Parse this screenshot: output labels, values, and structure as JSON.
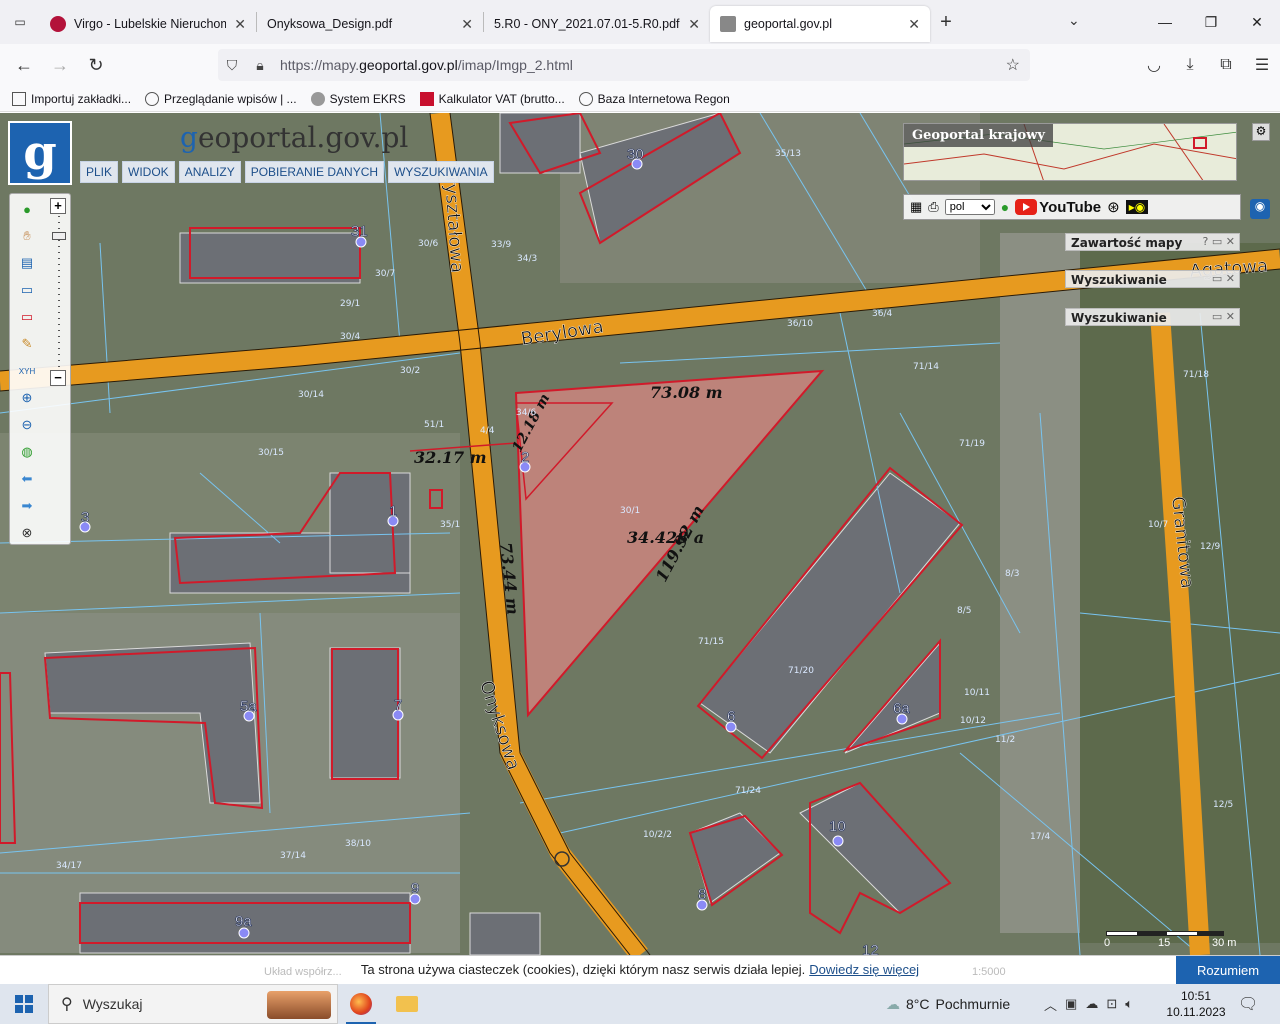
{
  "browser": {
    "tabs": [
      {
        "title": "Virgo - Lubelskie Nieruchomoś",
        "favicon_color": "#b3123a"
      },
      {
        "title": "Onyksowa_Design.pdf",
        "favicon_color": ""
      },
      {
        "title": "5.R0 - ONY_2021.07.01-5.R0.pdf",
        "favicon_color": ""
      },
      {
        "title": "geoportal.gov.pl",
        "favicon_color": "#777"
      }
    ],
    "active_tab": 3,
    "url_prefix": "https://mapy.",
    "url_domain": "geoportal.gov.pl",
    "url_suffix": "/imap/Imgp_2.html",
    "bookmarks": [
      "Importuj zakładki...",
      "Przeglądanie wpisów | ...",
      "System EKRS",
      "Kalkulator VAT (brutto...",
      "Baza Internetowa Regon"
    ]
  },
  "geoportal": {
    "logo_letter": "g",
    "logo_text_accent": "g",
    "logo_text_rest": "eoportal.gov.pl",
    "menu": [
      "PLIK",
      "WIDOK",
      "ANALIZY",
      "POBIERANIE DANYCH",
      "WYSZUKIWANIA"
    ],
    "overview_label": "Geoportal krajowy",
    "language": "pol",
    "youtube_label": "YouTube",
    "panels": [
      {
        "title": "Zawartość mapy",
        "controls": "?  ▭  ✕"
      },
      {
        "title": "Wyszukiwanie",
        "controls": "▭  ✕"
      },
      {
        "title": "Wyszukiwanie",
        "controls": "▭  ✕"
      }
    ],
    "scale_labels": [
      "0",
      "15",
      "30 m"
    ],
    "tools": [
      "info-icon",
      "pan-hand-icon",
      "layers-icon",
      "select-icon",
      "select-red-icon",
      "pencil-icon",
      "xyh-icon",
      "zoom-in-icon",
      "zoom-out-icon",
      "globe-icon",
      "back-arrow-icon",
      "forward-arrow-icon",
      "reset-icon"
    ]
  },
  "map": {
    "streets": [
      "Berylowa",
      "Onyksowa",
      "Granitowa",
      "Agatowa",
      "Kryształowa"
    ],
    "measurements": [
      "73.08 m",
      "32.17 m",
      "12.18 m",
      "73.44 m",
      "119.92 m",
      "34.428 a"
    ],
    "building_numbers": [
      "30",
      "31",
      "1",
      "2",
      "3",
      "5a",
      "7",
      "6",
      "6a",
      "8",
      "9",
      "9a",
      "10",
      "12"
    ],
    "parcel_labels": [
      "35/13",
      "33/9",
      "34/3",
      "30/6",
      "30/7",
      "29/1",
      "30/4",
      "36/10",
      "36/4",
      "71/14",
      "71/19",
      "30/14",
      "30/15",
      "30/2",
      "51/1",
      "4/4",
      "34/6",
      "30/1",
      "35/1",
      "71/15",
      "71/20",
      "8/3",
      "8/5",
      "10/7",
      "12/9",
      "71/18",
      "10/11",
      "10/12",
      "11/2",
      "71/24",
      "37/14",
      "38/10",
      "34/17",
      "10/2/2",
      "17/4",
      "12/5"
    ]
  },
  "cookie_bar": {
    "text": "Ta strona używa ciasteczek (cookies), dzięki którym nasz serwis działa lepiej.",
    "link": "Dowiedz się więcej",
    "button": "Rozumiem",
    "ghost_left": "Układ współrz...",
    "ghost_right": "1:5000"
  },
  "taskbar": {
    "search_placeholder": "Wyszukaj",
    "weather_temp": "8°C",
    "weather_desc": "Pochmurnie",
    "time": "10:51",
    "date": "10.11.2023"
  },
  "colors": {
    "accent": "#1d63b0",
    "road": "#e79a1f",
    "parcel_red": "#d11a2a",
    "highlight": "#f28b8b"
  }
}
